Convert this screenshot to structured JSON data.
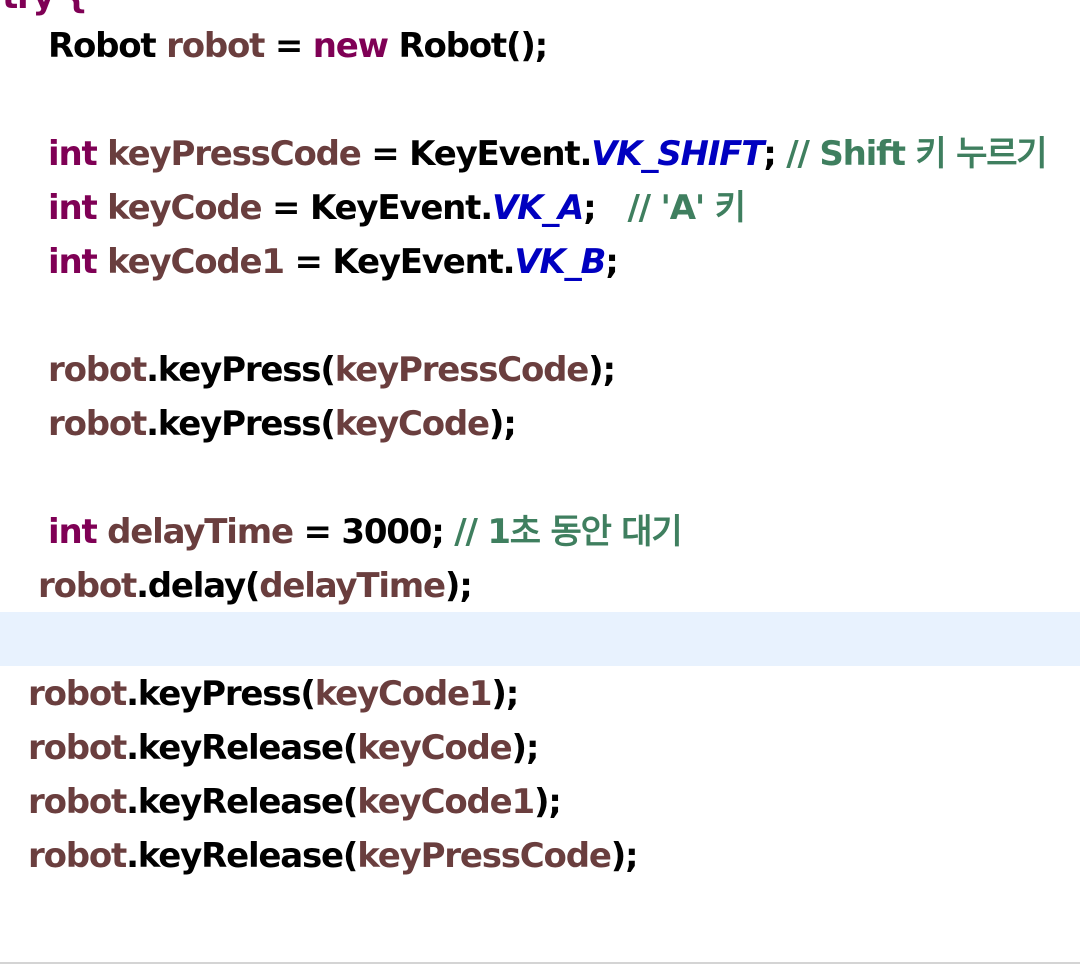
{
  "code": {
    "top_partial": "try {",
    "l1": {
      "type": "Robot",
      "var": "robot",
      "eq": " = ",
      "new": "new",
      "rest": " Robot();"
    },
    "l2": {
      "kw": "int",
      "var": "keyPressCode",
      "eq": " = KeyEvent.",
      "const": "VK_SHIFT",
      "semi": "; ",
      "comment": "// Shift 키 누르기"
    },
    "l3": {
      "kw": "int",
      "var": "keyCode",
      "eq": " = KeyEvent.",
      "const": "VK_A",
      "semi": ";   ",
      "comment": "// 'A' 키"
    },
    "l4": {
      "kw": "int",
      "var": "keyCode1",
      "eq": " = KeyEvent.",
      "const": "VK_B",
      "semi": ";"
    },
    "l5": {
      "obj": "robot",
      "method": ".keyPress(",
      "arg": "keyPressCode",
      "end": ");"
    },
    "l6": {
      "obj": "robot",
      "method": ".keyPress(",
      "arg": "keyCode",
      "end": ");"
    },
    "l7": {
      "kw": "int",
      "var": "delayTime",
      "eq": " = 3000; ",
      "comment": "// 1초 동안 대기"
    },
    "l8": {
      "obj": "robot",
      "method": ".delay(",
      "arg": "delayTime",
      "end": ");"
    },
    "l9": {
      "obj": "robot",
      "method": ".keyPress(",
      "arg": "keyCode1",
      "end": ");"
    },
    "l10": {
      "obj": "robot",
      "method": ".keyRelease(",
      "arg": "keyCode",
      "end": ");"
    },
    "l11": {
      "obj": "robot",
      "method": ".keyRelease(",
      "arg": "keyCode1",
      "end": ");"
    },
    "l12": {
      "obj": "robot",
      "method": ".keyRelease(",
      "arg": "keyPressCode",
      "end": ");"
    }
  },
  "colors": {
    "keyword": "#7f0055",
    "variable": "#6a3e3e",
    "constant": "#0000c0",
    "comment": "#3f7f5f",
    "current_line": "#e8f2fe"
  }
}
